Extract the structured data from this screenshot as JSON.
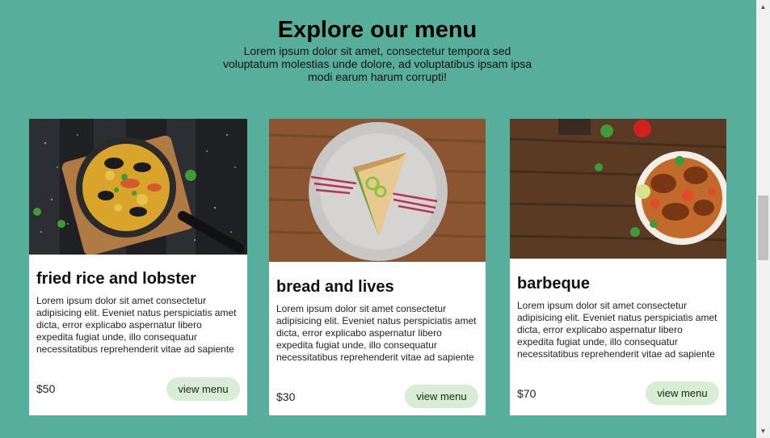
{
  "hero": {
    "title": "Explore our menu",
    "subtitle": "Lorem ipsum dolor sit amet, consectetur tempora sed voluptatum molestias unde dolore, ad voluptatibus ipsam ipsa modi earum harum corrupti!"
  },
  "cards": [
    {
      "title": "fried rice and lobster",
      "description": "Lorem ipsum dolor sit amet consectetur adipisicing elit. Eveniet natus perspiciatis amet dicta, error explicabo aspernatur libero expedita fugiat unde, illo consequatur necessitatibus reprehenderit vitae ad sapiente",
      "price": "$50",
      "button_label": "view menu"
    },
    {
      "title": "bread and lives",
      "description": "Lorem ipsum dolor sit amet consectetur adipisicing elit. Eveniet natus perspiciatis amet dicta, error explicabo aspernatur libero expedita fugiat unde, illo consequatur necessitatibus reprehenderit vitae ad sapiente",
      "price": "$30",
      "button_label": "view menu"
    },
    {
      "title": "barbeque",
      "description": "Lorem ipsum dolor sit amet consectetur adipisicing elit. Eveniet natus perspiciatis amet dicta, error explicabo aspernatur libero expedita fugiat unde, illo consequatur necessitatibus reprehenderit vitae ad sapiente",
      "price": "$70",
      "button_label": "view menu"
    }
  ],
  "scrollbar": {
    "up_icon": "arrow-up-icon",
    "down_icon": "arrow-down-icon"
  },
  "colors": {
    "background": "#56ae9b",
    "button": "#d8eed4",
    "card": "#ffffff"
  }
}
